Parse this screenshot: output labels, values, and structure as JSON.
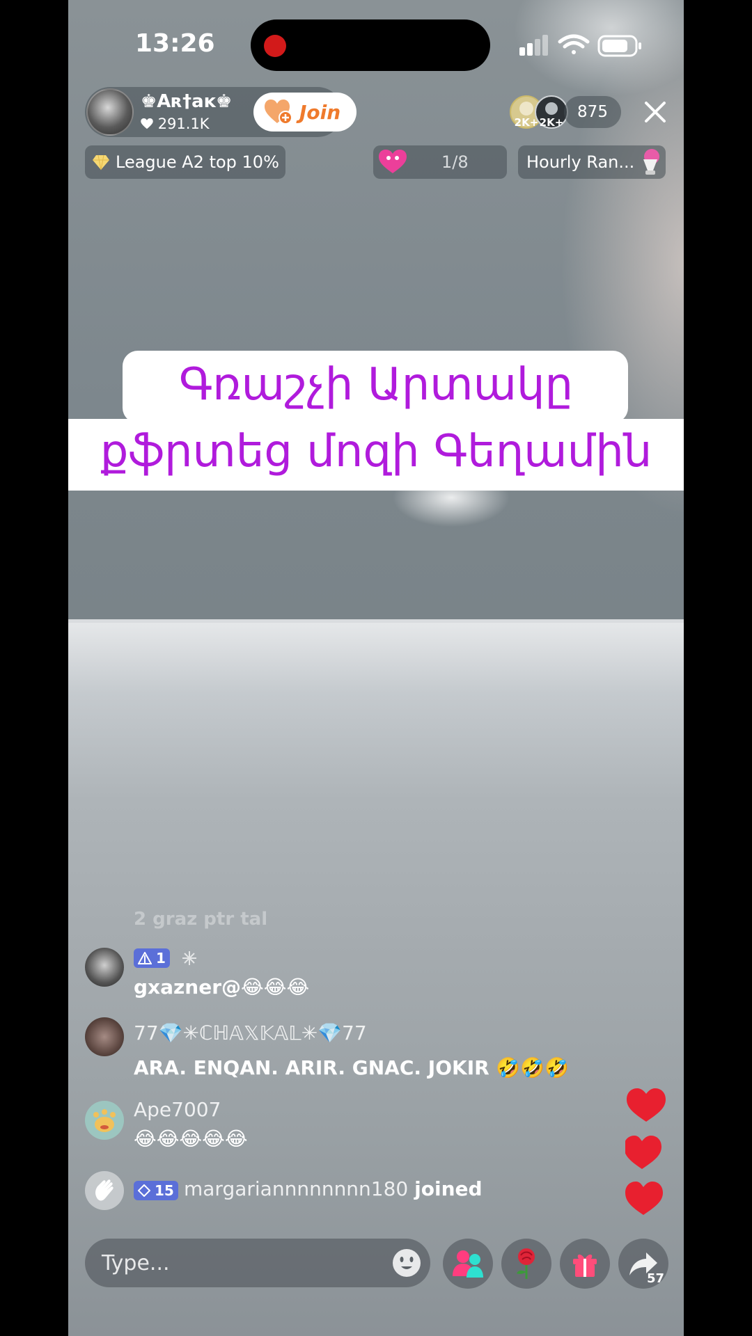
{
  "status_bar": {
    "time": "13:26"
  },
  "host": {
    "name": "♚Aʀ†aĸ♚",
    "likes": "291.1K",
    "join_label": "Join"
  },
  "viewers": {
    "badge_1": "2K+",
    "badge_2": "2K+",
    "count": "875"
  },
  "pills": {
    "league": "League A2 top 10%",
    "rank_fraction": "1/8",
    "hourly": "Hourly Ran..."
  },
  "caption": {
    "line1": "Գռաշչի Արտակը",
    "line2": "քֆրտեց մոզի Գեղամին"
  },
  "comments": {
    "faded_text": "2 graz ptr tal",
    "items": [
      {
        "badge_level": "1",
        "username": "",
        "message": "gxazner@😂😂😂"
      },
      {
        "badge_level": "",
        "username": "77💎✳ℂℍ𝔸𝕏𝕂𝔸𝕃✳💎77",
        "message": "ARA. ENQAN.  ARIR. GNAC. JOKIR 🤣🤣🤣"
      },
      {
        "badge_level": "",
        "username": "Ape7007",
        "message": "😂😂😂😂😂"
      }
    ],
    "join_event": {
      "badge_level": "15",
      "username": "margariannnnnnnn180",
      "suffix": "joined"
    }
  },
  "bottom_bar": {
    "placeholder": "Type...",
    "share_count": "57"
  },
  "colors": {
    "caption_text": "#b01bdc",
    "join_text": "#ef7a2c",
    "heart": "#e8202f",
    "badge_blue": "#5b6fd8"
  },
  "icons": [
    "battery-icon",
    "wifi-icon",
    "signal-icon",
    "close-icon",
    "diamond-icon",
    "heart-icon",
    "emoji-icon",
    "multi-guest-icon",
    "rose-icon",
    "gift-icon",
    "share-icon",
    "wave-icon"
  ]
}
